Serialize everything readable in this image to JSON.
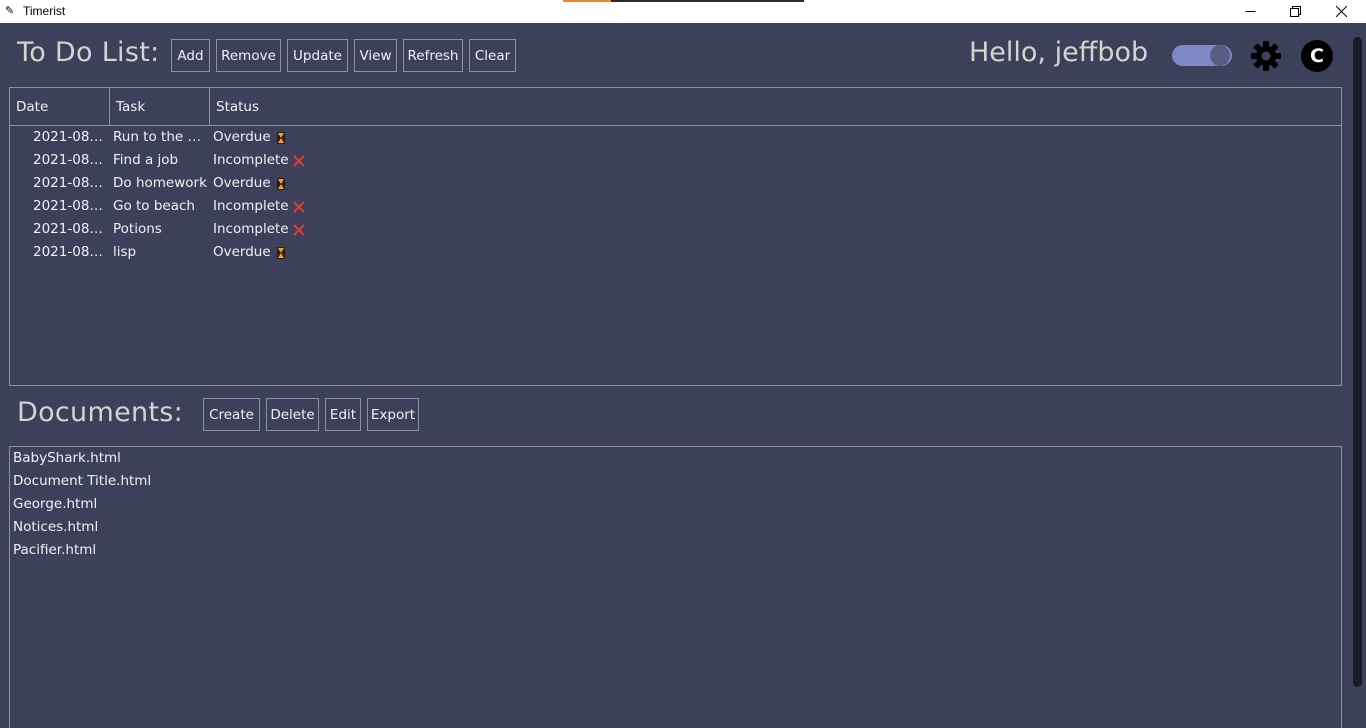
{
  "window": {
    "title": "Timerist",
    "app_icon": "pencil-icon"
  },
  "todo": {
    "title": "To Do List:",
    "buttons": [
      "Add",
      "Remove",
      "Update",
      "View",
      "Refresh",
      "Clear"
    ],
    "columns": [
      "Date",
      "Task",
      "Status"
    ],
    "rows": [
      {
        "date": "2021-08-...",
        "task": "Run to the m...",
        "status": "Overdue",
        "icon": "hourglass-icon"
      },
      {
        "date": "2021-08-...",
        "task": "Find a job",
        "status": "Incomplete",
        "icon": "cross-icon"
      },
      {
        "date": "2021-08-...",
        "task": "Do homework",
        "status": "Overdue",
        "icon": "hourglass-icon"
      },
      {
        "date": "2021-08-...",
        "task": "Go to beach",
        "status": "Incomplete",
        "icon": "cross-icon"
      },
      {
        "date": "2021-08-...",
        "task": "Potions",
        "status": "Incomplete",
        "icon": "cross-icon"
      },
      {
        "date": "2021-08-...",
        "task": "lisp",
        "status": "Overdue",
        "icon": "hourglass-icon"
      }
    ]
  },
  "user": {
    "greeting": "Hello, jeffbob",
    "avatar_letter": "C"
  },
  "documents": {
    "title": "Documents:",
    "buttons": [
      "Create",
      "Delete",
      "Edit",
      "Export"
    ],
    "files": [
      "BabyShark.html",
      "Document Title.html",
      "George.html",
      "Notices.html",
      "Pacifier.html"
    ]
  },
  "colors": {
    "background": "#3c405b",
    "border": "#8d90a5",
    "toggle": "#8087c6",
    "cross": "#d8402a",
    "hourglass": "#e8a23a"
  }
}
